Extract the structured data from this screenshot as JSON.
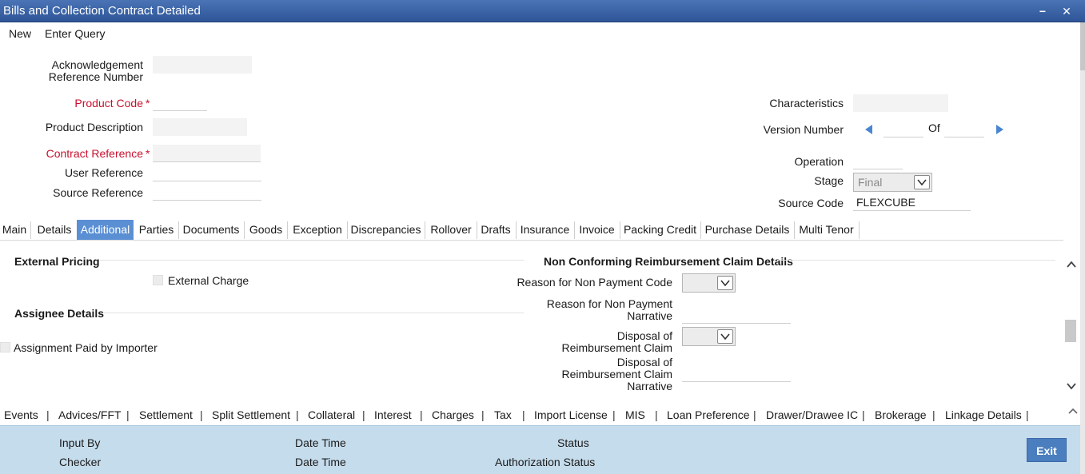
{
  "window": {
    "title": "Bills and Collection Contract Detailed",
    "minimize_label": "−",
    "close_label": "✕"
  },
  "menu": {
    "new": "New",
    "enter_query": "Enter Query"
  },
  "header": {
    "ack_ref_label": "Acknowledgement Reference Number",
    "ack_ref_value": "",
    "product_code_label": "Product Code",
    "product_code_value": "",
    "product_desc_label": "Product Description",
    "product_desc_value": "",
    "contract_ref_label": "Contract Reference",
    "contract_ref_value": "",
    "user_ref_label": "User Reference",
    "user_ref_value": "",
    "source_ref_label": "Source Reference",
    "source_ref_value": "",
    "required_mark": "*",
    "characteristics_label": "Characteristics",
    "characteristics_value": "",
    "version_label": "Version Number",
    "version_value": "",
    "version_of_label": "Of",
    "version_of_value": "",
    "operation_label": "Operation",
    "operation_value": "",
    "stage_label": "Stage",
    "stage_value": "Final",
    "source_code_label": "Source Code",
    "source_code_value": "FLEXCUBE"
  },
  "tabs": [
    "Main",
    "Details",
    "Additional",
    "Parties",
    "Documents",
    "Goods",
    "Exception",
    "Discrepancies",
    "Rollover",
    "Drafts",
    "Insurance",
    "Invoice",
    "Packing Credit",
    "Purchase Details",
    "Multi Tenor"
  ],
  "active_tab": "Additional",
  "additional": {
    "external_pricing_title": "External Pricing",
    "external_charge_label": "External Charge",
    "external_charge_checked": false,
    "assignee_title": "Assignee Details",
    "assignment_paid_label": "Assignment Paid by Importer",
    "assignment_paid_checked": false,
    "ncr_title": "Non Conforming Reimbursement Claim Details",
    "reason_code_label": "Reason for Non Payment Code",
    "reason_code_value": "",
    "reason_narrative_label": "Reason for Non Payment Narrative",
    "reason_narrative_value": "",
    "disposal_label": "Disposal of Reimbursement Claim",
    "disposal_value": "",
    "disposal_narrative_label": "Disposal of Reimbursement Claim Narrative",
    "disposal_narrative_value": ""
  },
  "bottom_nav": [
    "Events",
    "Advices/FFT",
    "Settlement",
    "Split Settlement",
    "Collateral",
    "Interest",
    "Charges",
    "Tax",
    "Import License",
    "MIS",
    "Loan Preference",
    "Drawer/Drawee IC",
    "Brokerage",
    "Linkage Details"
  ],
  "bottom_nav_separator": "|",
  "footer": {
    "input_by": "Input By",
    "date_time_1": "Date Time",
    "status": "Status",
    "checker": "Checker",
    "date_time_2": "Date Time",
    "auth_status": "Authorization Status",
    "exit": "Exit"
  },
  "colors": {
    "title_bar": "#2f5597",
    "active_tab": "#5b8fd3",
    "required": "#c8102e",
    "footer": "#c5dcec",
    "exit_button": "#4a7ebf"
  }
}
